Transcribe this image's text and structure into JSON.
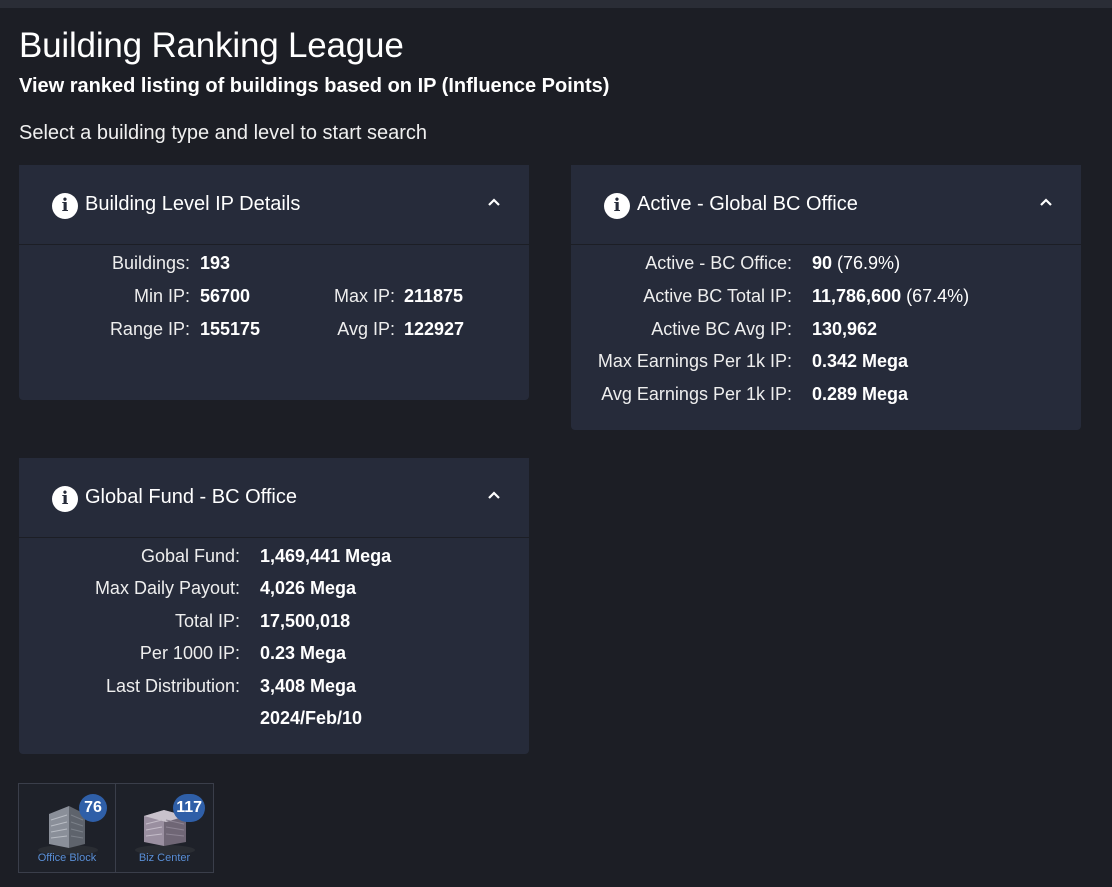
{
  "header": {
    "title": "Building Ranking League",
    "subtitle": "View ranked listing of buildings based on IP (Influence Points)",
    "prompt": "Select a building type and level to start search"
  },
  "card_level": {
    "title": "Building Level IP Details",
    "buildings_label": "Buildings:",
    "buildings_value": "193",
    "min_label": "Min IP:",
    "min_value": "56700",
    "max_label": "Max IP:",
    "max_value": "211875",
    "range_label": "Range IP:",
    "range_value": "155175",
    "avg_label": "Avg IP:",
    "avg_value": "122927"
  },
  "card_active": {
    "title": "Active - Global BC Office",
    "rows": [
      {
        "label": "Active - BC Office:",
        "value": "90",
        "suffix": " (76.9%)"
      },
      {
        "label": "Active BC Total IP:",
        "value": "11,786,600",
        "suffix": " (67.4%)"
      },
      {
        "label": "Active BC Avg IP:",
        "value": "130,962",
        "suffix": ""
      },
      {
        "label": "Max Earnings Per 1k IP:",
        "value": "0.342 Mega",
        "suffix": ""
      },
      {
        "label": "Avg Earnings Per 1k IP:",
        "value": "0.289 Mega",
        "suffix": ""
      }
    ]
  },
  "card_fund": {
    "title": "Global Fund - BC Office",
    "rows": [
      {
        "label": "Gobal Fund:",
        "value": "1,469,441 Mega"
      },
      {
        "label": "Max Daily Payout:",
        "value": "4,026 Mega"
      },
      {
        "label": "Total IP:",
        "value": "17,500,018"
      },
      {
        "label": "Per 1000 IP:",
        "value": "0.23 Mega"
      },
      {
        "label": "Last Distribution:",
        "value": "3,408 Mega"
      },
      {
        "label": "",
        "value": "2024/Feb/10"
      }
    ]
  },
  "tiles": [
    {
      "label": "Office Block",
      "count": "76"
    },
    {
      "label": "Biz Center",
      "count": "117"
    }
  ],
  "colors": {
    "background": "#1c1e25",
    "card": "#262b3a",
    "badge": "#2f5fa8",
    "tile_label": "#5a8fd6"
  }
}
